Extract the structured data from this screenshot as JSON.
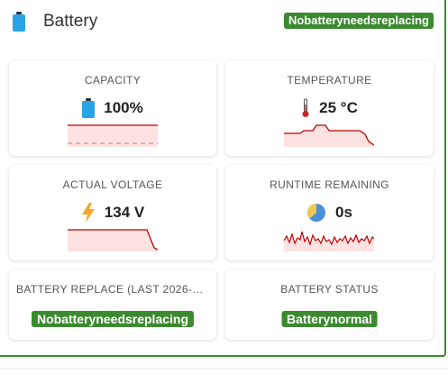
{
  "header": {
    "title": "Battery",
    "badge": "Nobatteryneedsreplacing"
  },
  "cards": {
    "capacity": {
      "title": "CAPACITY",
      "value": "100%"
    },
    "temperature": {
      "title": "TEMPERATURE",
      "value": "25 °C"
    },
    "voltage": {
      "title": "ACTUAL VOLTAGE",
      "value": "134 V"
    },
    "runtime": {
      "title": "RUNTIME REMAINING",
      "value": "0s"
    },
    "replace": {
      "title": "BATTERY REPLACE (LAST 2026-0…",
      "badge": "Nobatteryneedsreplacing"
    },
    "status": {
      "title": "BATTERY STATUS",
      "badge": "Batterynormal"
    }
  },
  "colors": {
    "accent": "#3b8a2f",
    "battery_icon": "#2aa3e6",
    "spark_line": "#c00000",
    "spark_fill": "#fde2e2",
    "bolt": "#f5a623",
    "thermometer": "#c62828",
    "pie_blue": "#4a90d9",
    "pie_yellow": "#f2c94c"
  },
  "icons": {
    "header": "battery-icon",
    "capacity": "battery-icon",
    "temperature": "thermometer-icon",
    "voltage": "lightning-bolt-icon",
    "runtime": "pie-chart-icon"
  }
}
